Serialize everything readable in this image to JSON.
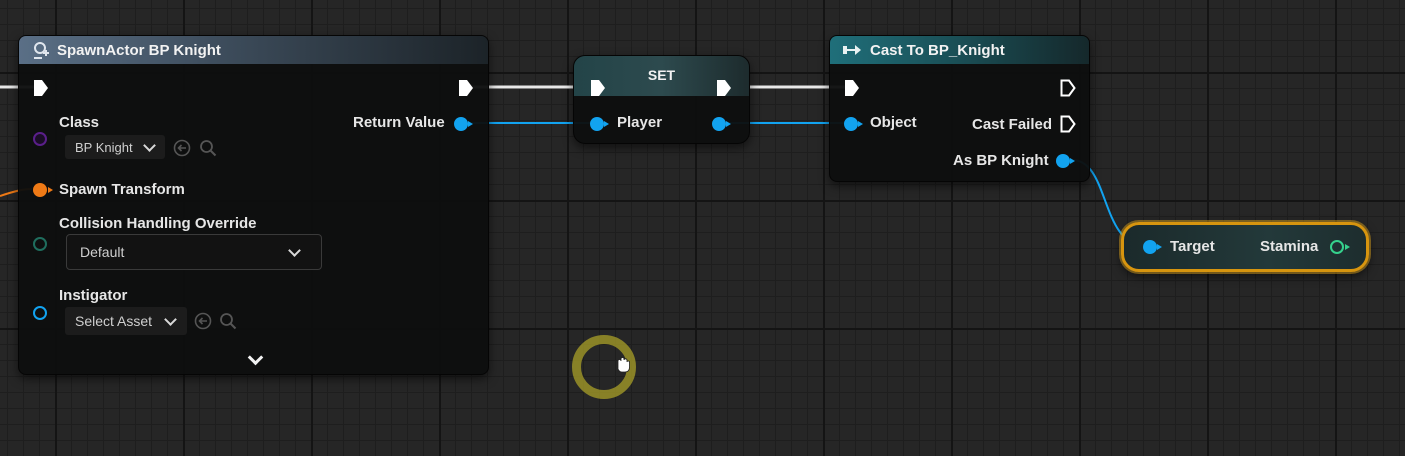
{
  "spawn_node": {
    "title": "SpawnActor BP Knight",
    "pins": {
      "class_label": "Class",
      "class_value": "BP Knight",
      "return_value_label": "Return Value",
      "spawn_transform_label": "Spawn Transform",
      "collision_label": "Collision Handling Override",
      "collision_value": "Default",
      "instigator_label": "Instigator",
      "instigator_value": "Select Asset"
    }
  },
  "set_node": {
    "title": "SET",
    "pin_label": "Player"
  },
  "cast_node": {
    "title": "Cast To BP_Knight",
    "object_label": "Object",
    "cast_failed_label": "Cast Failed",
    "as_label": "As BP Knight"
  },
  "stamina_node": {
    "target_label": "Target",
    "output_label": "Stamina"
  },
  "colors": {
    "exec": "#ffffff",
    "object_pin": "#12a3f0",
    "class_pin": "#5a1f8a",
    "transform_pin": "#ef7a16",
    "byte_pin": "#1f6e5e",
    "float_pin": "#35d18c",
    "selection": "#d7950f"
  }
}
